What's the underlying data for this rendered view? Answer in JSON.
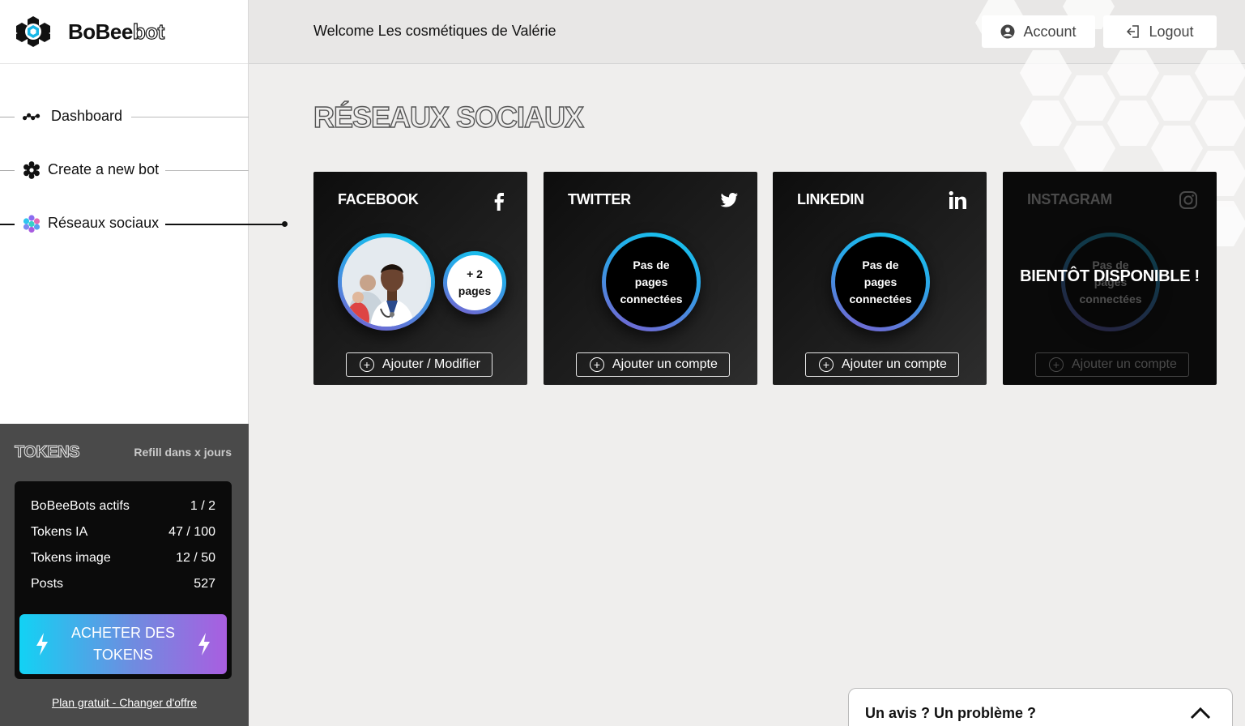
{
  "brand": {
    "name_part1": "BoBee",
    "name_part2": "bot"
  },
  "header": {
    "welcome": "Welcome Les cosmétiques de Valérie",
    "account_label": "Account",
    "logout_label": "Logout"
  },
  "nav": {
    "items": [
      {
        "label": "Dashboard",
        "icon": "dashboard-icon",
        "active": false
      },
      {
        "label": "Create a new bot",
        "icon": "gear-icon",
        "active": false
      },
      {
        "label": "Réseaux sociaux",
        "icon": "hexagons-icon",
        "active": true
      }
    ]
  },
  "tokens": {
    "title": "TOKENS",
    "refill": "Refill dans x jours",
    "rows": [
      {
        "label": "BoBeeBots actifs",
        "value": "1 / 2"
      },
      {
        "label": "Tokens IA",
        "value": "47 / 100"
      },
      {
        "label": "Tokens image",
        "value": "12 / 50"
      },
      {
        "label": "Posts",
        "value": "527"
      }
    ],
    "buy_label": "ACHETER DES TOKENS",
    "plan_link": "Plan gratuit - Changer d'offre"
  },
  "page": {
    "title": "RÉSEAUX SOCIAUX"
  },
  "cards": [
    {
      "network": "FACEBOOK",
      "icon": "facebook-icon",
      "extra_pages": "+ 2",
      "extra_pages_label": "pages",
      "button": "Ajouter / Modifier"
    },
    {
      "network": "TWITTER",
      "icon": "twitter-icon",
      "status": "Pas de pages connectées",
      "button": "Ajouter un compte"
    },
    {
      "network": "LINKEDIN",
      "icon": "linkedin-icon",
      "status": "Pas de pages connectées",
      "button": "Ajouter un compte"
    },
    {
      "network": "INSTAGRAM",
      "icon": "instagram-icon",
      "status": "Pas de pages connectées",
      "button": "Ajouter un compte",
      "overlay": "BIENTÔT DISPONIBLE !"
    }
  ],
  "feedback": {
    "label": "Un avis ? Un problème ?"
  },
  "colors": {
    "accent_cyan": "#12d2f4",
    "accent_purple": "#a95ee0",
    "panel_dark": "#4a4a4a"
  }
}
